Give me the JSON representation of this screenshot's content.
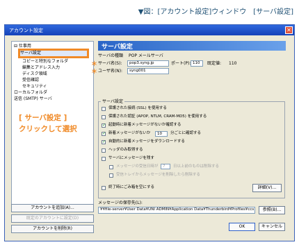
{
  "caption": "▼図：[アカウント設定]ウィンドウ　[サーバ設定]",
  "window": {
    "title": "アカウント設定",
    "close_glyph": "✕"
  },
  "sidebar": {
    "root": "⊟ 仕事用",
    "items": [
      "サーバ設定",
      "コピーと特別なフォルダ",
      "編集とアドレス入力",
      "ディスク領域",
      "受信確認",
      "セキュリティ",
      "ローカルフォルダ",
      "送信 (SMTP) サーバ"
    ],
    "callout": [
      "[ サーバ設定 ]",
      "クリックして選択"
    ],
    "buttons": [
      "アカウントを追加(A)...",
      "既定のアカウントに設定(D)",
      "アカウントを削除(R)"
    ]
  },
  "panel": {
    "title": "サーバ設定",
    "server_type_label": "サーバの種類",
    "server_type_value": "POP メールサーバ",
    "server_name_label": "サーバ名(S):",
    "server_name_value": "pop3.syng.jp",
    "port_label": "ポート(P):",
    "port_value": "110",
    "default_port_label": "既定値:",
    "default_port_value": "110",
    "user_name_label": "ユーザ名(N):",
    "user_name_value": "syng001",
    "asterisk": "＊",
    "group_title": "サーバ設定",
    "options": [
      "保護された接続 (SSL) を使用する",
      "保護された認証 (APOP, NTLM, CRAM-MD5) を使用する",
      "起動時に新着メッセージがないか確認する",
      "新着メッセージがないか",
      "分ごとに確認する",
      "自動的に新着メッセージをダウンロードする",
      "ヘッダのみ取得する",
      "サーバにメッセージを残す",
      "メッセージの受信日時が",
      "日以上前のものは削除する",
      "受信トレイからメッセージを削除したら削除する",
      "終了時にごみ箱を空にする"
    ],
    "check_interval": "10",
    "keep_days": "7",
    "detail_button": "詳細(V)...",
    "storage_label": "メッセージの保存先(L):",
    "storage_path": "¥¥file-server¥User Data¥UNI ADMIN¥Application Data¥Thunderbird¥Profiles¥ccs",
    "browse_button": "参照(B)..."
  },
  "footer": {
    "ok": "OK",
    "cancel": "キャンセル"
  }
}
